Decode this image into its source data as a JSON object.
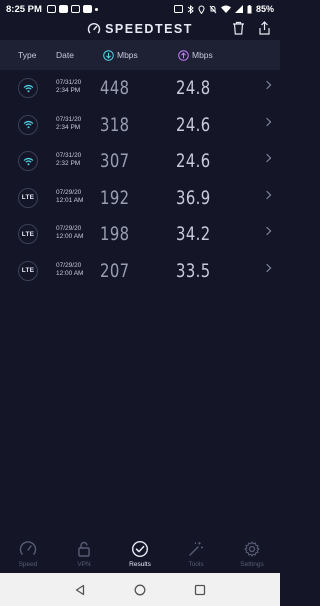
{
  "status_bar": {
    "time": "8:25 PM",
    "battery": "85%"
  },
  "app": {
    "title": "SPEEDTEST"
  },
  "columns": {
    "type": "Type",
    "date": "Date",
    "download_unit": "Mbps",
    "upload_unit": "Mbps"
  },
  "results": [
    {
      "type": "wifi",
      "date": "07/31/20",
      "time": "2:34 PM",
      "download": "448",
      "upload": "24.8"
    },
    {
      "type": "wifi",
      "date": "07/31/20",
      "time": "2:34 PM",
      "download": "318",
      "upload": "24.6"
    },
    {
      "type": "wifi",
      "date": "07/31/20",
      "time": "2:32 PM",
      "download": "307",
      "upload": "24.6"
    },
    {
      "type": "lte",
      "type_label": "LTE",
      "date": "07/29/20",
      "time": "12:01 AM",
      "download": "192",
      "upload": "36.9"
    },
    {
      "type": "lte",
      "type_label": "LTE",
      "date": "07/29/20",
      "time": "12:00 AM",
      "download": "198",
      "upload": "34.2"
    },
    {
      "type": "lte",
      "type_label": "LTE",
      "date": "07/29/20",
      "time": "12:00 AM",
      "download": "207",
      "upload": "33.5"
    }
  ],
  "nav": [
    {
      "label": "Speed",
      "icon": "gauge-icon"
    },
    {
      "label": "VPN",
      "icon": "lock-icon"
    },
    {
      "label": "Results",
      "icon": "check-circle-icon",
      "active": true
    },
    {
      "label": "Tools",
      "icon": "wand-icon"
    },
    {
      "label": "Settings",
      "icon": "gear-icon"
    }
  ],
  "colors": {
    "background": "#141527",
    "header": "#1e2033",
    "download_accent": "#4fd6e6",
    "upload_accent": "#c77dff",
    "active_nav": "#e8e9f3",
    "inactive_nav": "#585c74"
  }
}
